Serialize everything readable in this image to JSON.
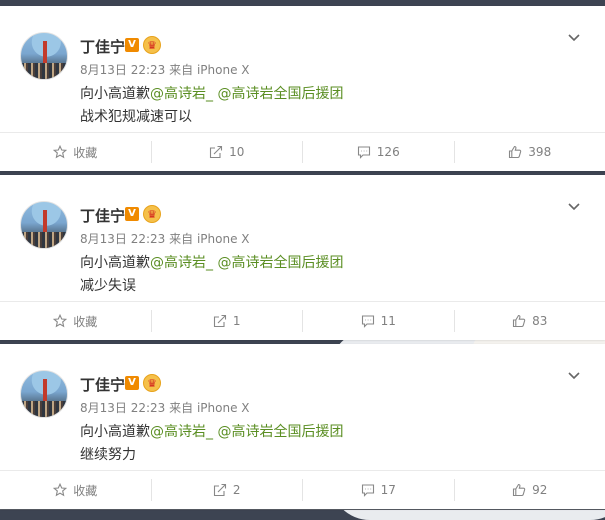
{
  "posts": [
    {
      "author": "丁佳宁",
      "verified_badge": "V",
      "crown_badge": "♛",
      "date": "8月13日 22:23",
      "source": "来自 iPhone X",
      "line1_prefix": "向小高道歉",
      "mention1": "@高诗岩_",
      "mention2": "@高诗岩全国后援团",
      "line2": "战术犯规减速可以",
      "collect_label": "收藏",
      "repost_count": "10",
      "comment_count": "126",
      "like_count": "398"
    },
    {
      "author": "丁佳宁",
      "verified_badge": "V",
      "crown_badge": "♛",
      "date": "8月13日 22:23",
      "source": "来自 iPhone X",
      "line1_prefix": "向小高道歉",
      "mention1": "@高诗岩_",
      "mention2": "@高诗岩全国后援团",
      "line2": "减少失误",
      "collect_label": "收藏",
      "repost_count": "1",
      "comment_count": "11",
      "like_count": "83"
    },
    {
      "author": "丁佳宁",
      "verified_badge": "V",
      "crown_badge": "♛",
      "date": "8月13日 22:23",
      "source": "来自 iPhone X",
      "line1_prefix": "向小高道歉",
      "mention1": "@高诗岩_",
      "mention2": "@高诗岩全国后援团",
      "line2": "继续努力",
      "collect_label": "收藏",
      "repost_count": "2",
      "comment_count": "17",
      "like_count": "92"
    }
  ],
  "colors": {
    "mention": "#5a8e22",
    "verified": "#f08a00",
    "text_muted": "#808080"
  }
}
